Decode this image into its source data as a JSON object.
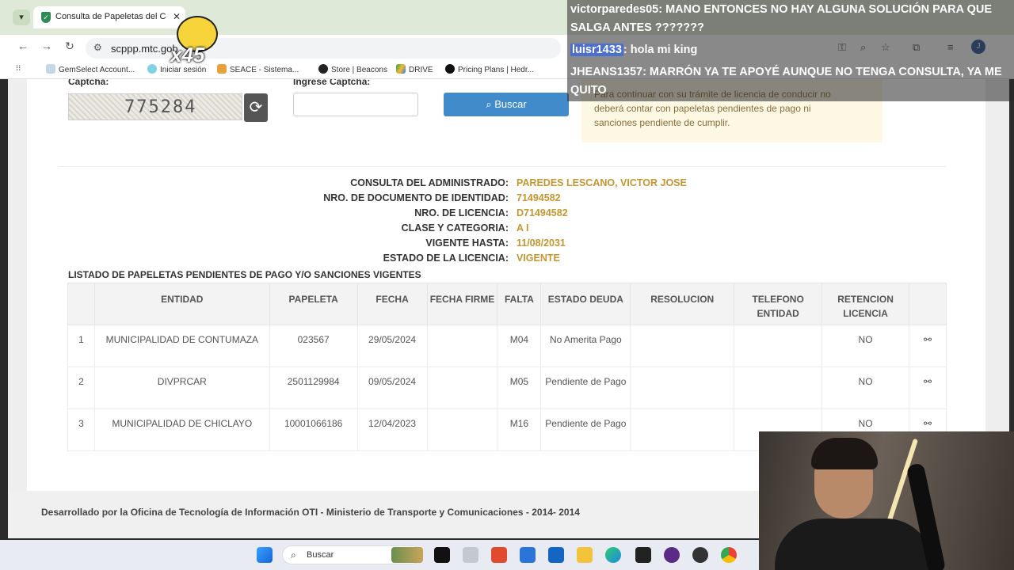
{
  "browser": {
    "tab_title": "Consulta de Papeletas del Ciud",
    "url": "scppp.mtc.gob",
    "avatar_letter": "J",
    "bookmarks": [
      {
        "label": "GemSelect Account..."
      },
      {
        "label": "Iniciar sesión"
      },
      {
        "label": "SEACE - Sistema..."
      },
      {
        "label": "Store | Beacons"
      },
      {
        "label": "DRIVE"
      },
      {
        "label": "Pricing Plans | Hedr..."
      }
    ]
  },
  "form": {
    "captcha_label": "Captcha:",
    "captcha_input_label": "Ingrese Captcha:",
    "captcha_code": "775284",
    "search_button": "Buscar",
    "notice": "Para continuar con su trámite de licencia de conducir no deberá contar con papeletas pendientes de pago ni sanciones pendiente de cumplir."
  },
  "info": [
    {
      "label": "CONSULTA DEL ADMINISTRADO:",
      "value": "PAREDES LESCANO, VICTOR JOSE"
    },
    {
      "label": "NRO. DE DOCUMENTO DE IDENTIDAD:",
      "value": "71494582"
    },
    {
      "label": "NRO. DE LICENCIA:",
      "value": "D71494582"
    },
    {
      "label": "CLASE Y CATEGORIA:",
      "value": "A I"
    },
    {
      "label": "VIGENTE HASTA:",
      "value": "11/08/2031"
    },
    {
      "label": "ESTADO DE LA LICENCIA:",
      "value": "VIGENTE"
    }
  ],
  "list_title": "LISTADO DE PAPELETAS PENDIENTES DE PAGO Y/O SANCIONES VIGENTES",
  "table": {
    "headers": [
      "",
      "ENTIDAD",
      "PAPELETA",
      "FECHA",
      "FECHA FIRME",
      "FALTA",
      "ESTADO DEUDA",
      "RESOLUCION",
      "TELEFONO ENTIDAD",
      "RETENCION LICENCIA",
      ""
    ],
    "rows": [
      {
        "n": "1",
        "entidad": "MUNICIPALIDAD DE CONTUMAZA",
        "papeleta": "023567",
        "fecha": "29/05/2024",
        "fecha_firme": "",
        "falta": "M04",
        "estado": "No Amerita Pago",
        "resolucion": "",
        "telefono": "",
        "retencion": "NO"
      },
      {
        "n": "2",
        "entidad": "DIVPRCAR",
        "papeleta": "2501129984",
        "fecha": "09/05/2024",
        "fecha_firme": "",
        "falta": "M05",
        "estado": "Pendiente de Pago",
        "resolucion": "",
        "telefono": "",
        "retencion": "NO"
      },
      {
        "n": "3",
        "entidad": "MUNICIPALIDAD DE CHICLAYO",
        "papeleta": "10001066186",
        "fecha": "12/04/2023",
        "fecha_firme": "",
        "falta": "M16",
        "estado": "Pendiente de Pago",
        "resolucion": "",
        "telefono": "",
        "retencion": "NO"
      }
    ]
  },
  "footer": "Desarrollado por la Oficina de Tecnología de Información OTI - Ministerio de Transporte y Comunicaciones - 2014- 2014",
  "taskbar": {
    "search_placeholder": "Buscar"
  },
  "overlay": {
    "sticker_text": "x45",
    "chat": [
      {
        "user": "victorparedes05",
        "msg": ": MANO ENTONCES NO HAY ALGUNA SOLUCIÓN PARA QUE",
        "cont": "SALGA ANTES ???????"
      },
      {
        "user": "luisr1433",
        "msg": ": hola mi king",
        "cont": ""
      },
      {
        "user": "JHEANS1357",
        "msg": ": MARRÓN YA TE APOYÉ AUNQUE NO TENGA CONSULTA, YA ME",
        "cont": "QUITO"
      }
    ]
  }
}
